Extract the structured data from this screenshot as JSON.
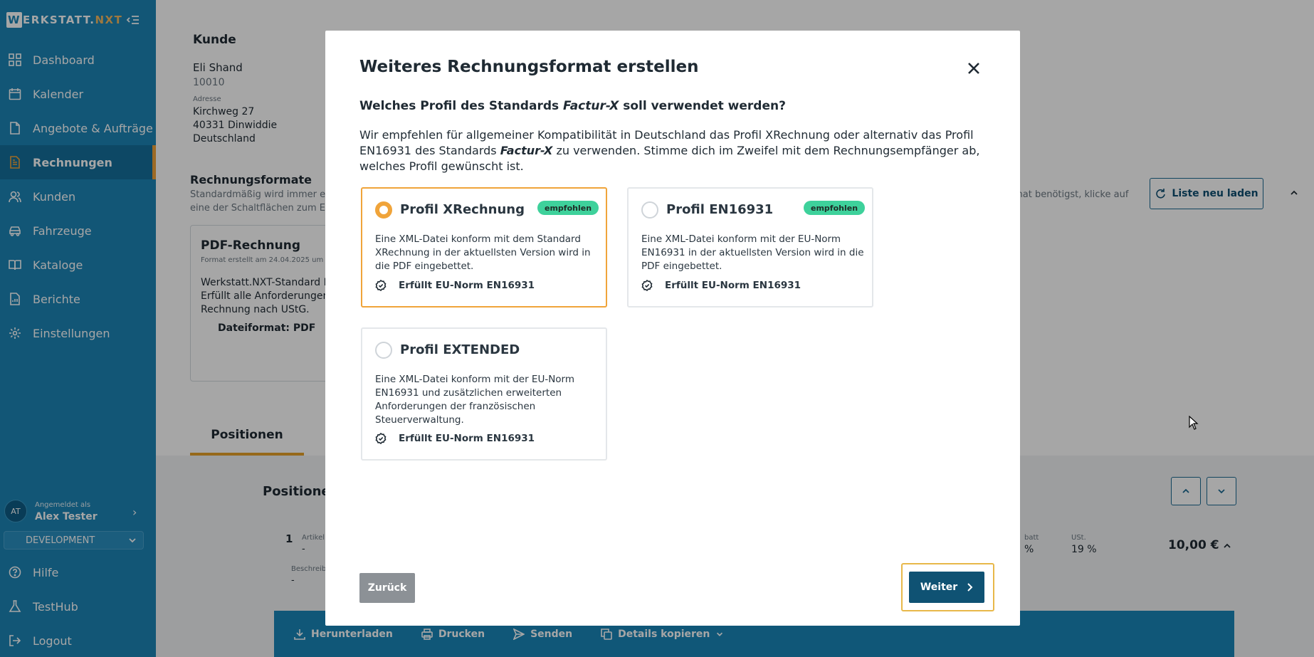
{
  "app": {
    "logo_w": "W",
    "logo_erkstatt": "ERKSTATT.",
    "logo_nxt": "NXT"
  },
  "sidebar": {
    "items": [
      {
        "label": "Dashboard",
        "icon": "dashboard-icon"
      },
      {
        "label": "Kalender",
        "icon": "calendar-icon"
      },
      {
        "label": "Angebote & Aufträge",
        "icon": "document-icon"
      },
      {
        "label": "Rechnungen",
        "icon": "invoice-icon",
        "active": true
      },
      {
        "label": "Kunden",
        "icon": "users-icon"
      },
      {
        "label": "Fahrzeuge",
        "icon": "car-icon"
      },
      {
        "label": "Kataloge",
        "icon": "book-icon"
      },
      {
        "label": "Berichte",
        "icon": "report-icon"
      },
      {
        "label": "Einstellungen",
        "icon": "gear-icon"
      }
    ],
    "user": {
      "initials": "AT",
      "caption": "Angemeldet als",
      "name": "Alex Tester"
    },
    "environment": "DEVELOPMENT",
    "bottom_items": [
      {
        "label": "Hilfe",
        "icon": "help-icon"
      },
      {
        "label": "TestHub",
        "icon": "flask-icon"
      },
      {
        "label": "Logout",
        "icon": "logout-icon"
      }
    ]
  },
  "main": {
    "customer_heading": "Kunde",
    "customer_name": "Eli Shand",
    "customer_number": "10010",
    "address_label": "Adresse",
    "address_line1": "Kirchweg 27",
    "address_line2": "40331 Dinwiddie",
    "address_line3": "Deutschland",
    "formats_heading": "Rechnungsformate",
    "formats_desc1": "Standardmäßig wird immer ein",
    "formats_desc2": "eine der Schaltflächen zum Ers",
    "formats_desc_right": "rmat benötigst, klicke auf",
    "reload_label": "Liste neu laden",
    "pdf_card_title": "PDF-Rechnung",
    "pdf_card_created": "Format erstellt am 24.04.2025 um",
    "pdf_card_line1": "Werkstatt.NXT-Standard Re",
    "pdf_card_line2": "Erfüllt alle Anforderungen a",
    "pdf_card_line3": "Rechnung nach UStG.",
    "pdf_card_format": "Dateiformat: PDF",
    "tab_positions": "Positionen",
    "positions_heading": "Positionen",
    "row_number": "1",
    "row_article_label": "Artikel",
    "row_article_value": "-",
    "row_desc_label": "Beschreib",
    "row_desc_value": "-",
    "row_discount_label": "batt",
    "row_discount_value": "%",
    "row_vat_label": "USt.",
    "row_vat_value": "19 %",
    "row_total": "10,00 €",
    "actions": {
      "download": "Herunterladen",
      "print": "Drucken",
      "send": "Senden",
      "copy": "Details kopieren"
    }
  },
  "modal": {
    "title": "Weiteres Rechnungsformat erstellen",
    "question_pre": "Welches Profil des Standards ",
    "question_std": "Factur-X",
    "question_post": " soll verwendet werden?",
    "desc_pre": "Wir empfehlen für allgemeiner Kompatibilität in Deutschland das Profil XRechnung oder alternativ das Profil EN16931 des Standards ",
    "desc_std": "Factur-X",
    "desc_post": " zu verwenden. Stimme dich im Zweifel mit dem Rechnungsempfänger ab, welches Profil gewünscht ist.",
    "options": [
      {
        "title": "Profil XRechnung",
        "badge": "empfohlen",
        "selected": true,
        "description": "Eine XML-Datei konform mit dem Standard XRechnung in der aktuellsten Version wird in die PDF eingebettet.",
        "norm": "Erfüllt EU-Norm EN16931"
      },
      {
        "title": "Profil EN16931",
        "badge": "empfohlen",
        "selected": false,
        "description": "Eine XML-Datei konform mit der EU-Norm EN16931 in der aktuellsten Version wird in die PDF eingebettet.",
        "norm": "Erfüllt EU-Norm EN16931"
      },
      {
        "title": "Profil EXTENDED",
        "badge": "",
        "selected": false,
        "description": "Eine XML-Datei konform mit der EU-Norm EN16931 und zusätzlichen erweiterten Anforderungen der französischen Steuerverwaltung.",
        "norm": "Erfüllt EU-Norm EN16931"
      }
    ],
    "back_label": "Zurück",
    "next_label": "Weiter"
  },
  "colors": {
    "sidebar": "#1c84b5",
    "accent": "#f0a43a",
    "badge": "#3ed19b",
    "primary_button": "#0f5273"
  }
}
